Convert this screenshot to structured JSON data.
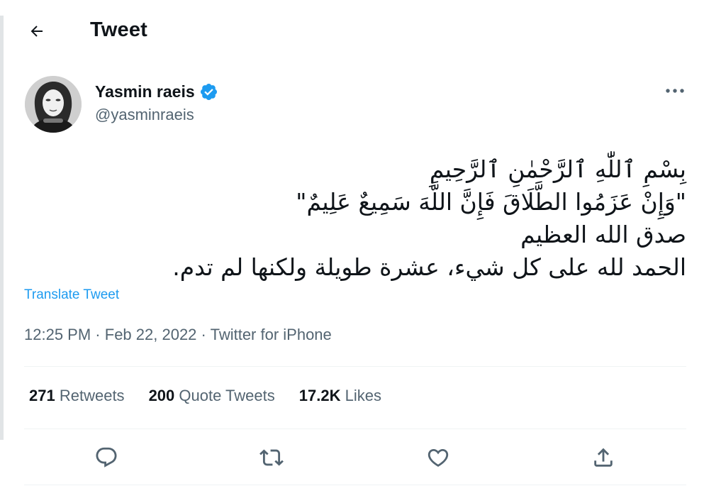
{
  "header": {
    "title": "Tweet",
    "back_icon": "arrow-left-icon"
  },
  "author": {
    "display_name": "Yasmin raeis",
    "handle": "@yasminraeis",
    "verified": true,
    "verified_color": "#1d9bf0"
  },
  "tweet": {
    "lines": [
      "بِسْمِ ٱللّٰهِ ٱلرَّحْمٰنِ ٱلرَّحِيمِ",
      "\"وَإِنْ عَزَمُوا الطَّلَاقَ فَإِنَّ اللَّهَ سَمِيعٌ عَلِيمٌ\"",
      "صدق الله العظيم",
      "الحمد لله على كل شيء، عشرة طويلة ولكنها لم تدم."
    ],
    "translate_label": "Translate Tweet"
  },
  "meta": {
    "time": "12:25 PM",
    "separator": "·",
    "date": "Feb 22, 2022",
    "source": "Twitter for iPhone"
  },
  "stats": {
    "retweets": {
      "count": "271",
      "label": "Retweets"
    },
    "quotes": {
      "count": "200",
      "label": "Quote Tweets"
    },
    "likes": {
      "count": "17.2K",
      "label": "Likes"
    }
  },
  "colors": {
    "accent": "#1d9bf0",
    "text": "#0f1419",
    "muted": "#536471"
  },
  "action_icons": [
    "reply-icon",
    "retweet-icon",
    "like-icon",
    "share-icon"
  ]
}
